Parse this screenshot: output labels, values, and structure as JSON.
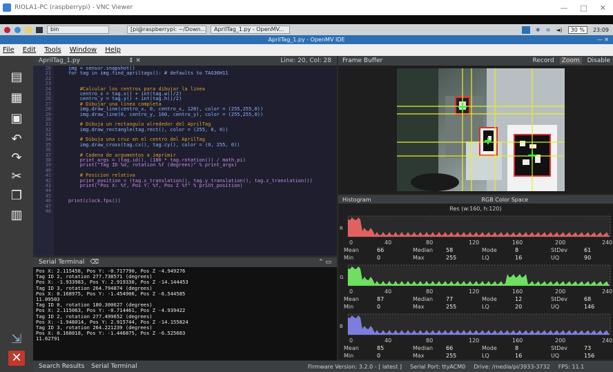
{
  "vnc_window": {
    "title": "RIOLA1-PC (raspberrypi) - VNC Viewer"
  },
  "panel": {
    "tasks": [
      "bin",
      "[pi@raspberrypi: ~/Down...",
      "AprilTag_1.py - OpenMV..."
    ],
    "cpu": "30 %",
    "clock": "23:09"
  },
  "ide": {
    "title": "AprilTag_1.py - OpenMV IDE"
  },
  "menu": [
    "File",
    "Edit",
    "Tools",
    "Window",
    "Help"
  ],
  "editor": {
    "filename": "AprilTag_1.py",
    "position": "Line: 20, Col: 28",
    "first_line": 20,
    "lines": [
      "    img = sensor.snapshot()",
      "    for tag in img.find_apriltags(): # defaults to TAG36H11",
      "",
      "",
      "        #Calcular los centros para dibujar la linea",
      "        centro_x = tag.x() + int(tag.w()/2)",
      "        centro_y = tag.y() + int(tag.h()/2)",
      "        # Dibujar una linea completa",
      "        img.draw_line(centro_x, 0, centro_x, 120), color = (255,255,0))",
      "        img.draw_line(0, centro_y, 160, centro_y), color = (255,255,0))",
      "",
      "        # Dibuja un rectangulo alrededor del AprilTag",
      "        img.draw_rectangle(tag.rect(), color = (255, 0, 0))",
      "",
      "        # Dibuja una cruz en el centro del AprilTag",
      "        img.draw_cross(tag.cx(), tag.cy(), color = (0, 255, 0))",
      "",
      "        # Cadena de argumentos a imprimir",
      "        print_args = (tag.id(), (180 * tag.rotation()) / math.pi)",
      "        print(\"Tag ID %d, rotation %f (degrees)\" % print_args)",
      "",
      "        # Posicion relativa",
      "        print_position = (tag.x_translation(), tag.y_translation(), tag.z_translation())",
      "        print(\"Pos X: %f, Pos Y: %f, Pos Z %f\" % print_position)",
      "",
      "",
      "    print(clock.fps())",
      "",
      ""
    ]
  },
  "terminal": {
    "title": "Serial Terminal",
    "lines": [
      "Pos X: 2.115458, Pos Y: -0.717790, Pos Z -4.949276",
      "Tag ID 2, rotation 277.738571 (degrees)",
      "Pos X: -1.933983, Pos Y: 2.919330, Pos Z -14.144453",
      "Tag ID 3, rotation 264.794874 (degrees)",
      "Pos X: 0.168975, Pos Y: -1.454906, Pos Z -6.544585",
      "11.09503",
      "Tag ID 0, rotation 180.300627 (degrees)",
      "Pos X: 2.115063, Pos Y: -0.714461, Pos Z -4.939422",
      "Tag ID 2, rotation 277.499652 (degrees)",
      "Pos X: -1.948014, Pos Y: 2.915744, Pos Z -14.155824",
      "Tag ID 3, rotation 264.221239 (degrees)",
      "Pos X: 0.168018, Pos Y: -1.446875, Pos Z -6.525683",
      "11.62791"
    ]
  },
  "bottom_tabs": [
    "Search Results",
    "Serial Terminal"
  ],
  "frame_buffer": {
    "title": "Frame Buffer",
    "record": "Record",
    "zoom": "Zoom",
    "disable": "Disable"
  },
  "histogram": {
    "title": "Histogram",
    "color_space": "RGB Color Space",
    "resolution": "Res (w:160, h:120)",
    "ticks": [
      "0",
      "40",
      "80",
      "120",
      "160",
      "200",
      "240"
    ],
    "channels": [
      {
        "name": "R",
        "color": "#ff6b6b",
        "mean": "66",
        "median": "58",
        "mode": "8",
        "stdev": "61",
        "min": "0",
        "max": "255",
        "lq": "16",
        "uq": "90"
      },
      {
        "name": "G",
        "color": "#7bff6b",
        "mean": "87",
        "median": "77",
        "mode": "12",
        "stdev": "68",
        "min": "0",
        "max": "255",
        "lq": "20",
        "uq": "146"
      },
      {
        "name": "B",
        "color": "#8c8cff",
        "mean": "85",
        "median": "66",
        "mode": "8",
        "stdev": "73",
        "min": "0",
        "max": "255",
        "lq": "16",
        "uq": "156"
      }
    ],
    "labels": {
      "mean": "Mean",
      "median": "Median",
      "mode": "Mode",
      "stdev": "StDev",
      "min": "Min",
      "max": "Max",
      "lq": "LQ",
      "uq": "UQ"
    }
  },
  "status": {
    "firmware": "Firmware Version: 3.2.0 - [ latest ]",
    "serial_port": "Serial Port: ttyACM0",
    "drive": "Drive: /media/pi/3933-3732",
    "fps": "FPS: 11.1"
  }
}
